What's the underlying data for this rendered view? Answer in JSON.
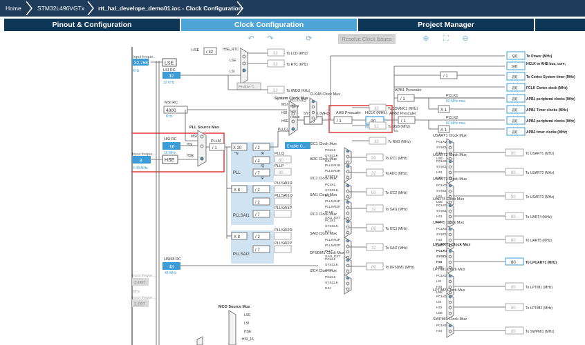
{
  "breadcrumb": {
    "home": "Home",
    "device": "STM32L496VGTx",
    "file": "rtt_hal_develope_demo01.ioc - Clock Configuration"
  },
  "tabs": {
    "pinout": "Pinout & Configuration",
    "clock": "Clock Configuration",
    "project": "Project Manager"
  },
  "toolbar": {
    "undo_icon": "undo-icon",
    "redo_icon": "redo-icon",
    "refresh_icon": "refresh-icon",
    "resolve": "Resolve Clock Issues",
    "zoom_in_icon": "zoom-in-icon",
    "fit_icon": "fit-screen-icon",
    "zoom_out_icon": "zoom-out-icon"
  },
  "sources": {
    "input_freq_lse_label": "Input freque...",
    "lse_value": "32.768",
    "lse_unit": "KHz",
    "lse": "LSE",
    "lsi_rc": "LSI RC",
    "lsi_value": "32",
    "lsi_unit": "32 KHz",
    "msi_rc": "MSI RC",
    "msi_value": "4000",
    "msi_unit": "KHz",
    "hsi_rc": "HSI RC",
    "hsi_value": "16",
    "hsi_unit": "16 MHz",
    "input_freq_hse_label": "Input freque...",
    "hse_value": "8",
    "hse_range": "4-48 MHz",
    "hse": "HSE",
    "hsi48_rc": "HSI48 RC",
    "hsi48_value": "48",
    "hsi48_unit": "48 MHz",
    "input_freq_3": "Input freque...",
    "input_3_value": "2.097",
    "input_3_unit": "MHz",
    "input_freq_4": "Input freque...",
    "input_4_value": "2.097"
  },
  "rtc": {
    "hse_label": "HSE",
    "hse_div": "/ 32",
    "hse_rtc": "HSE_RTC",
    "lse": "LSE",
    "lsi": "LSI",
    "enable_css": "Enable C...",
    "to_lcd": "To LCD (KHz)",
    "lcd_value": "32",
    "to_rtc": "To RTC (KHz)",
    "rtc_value": "32",
    "to_iwdg": "To IWDG (KHz)",
    "iwdg_value": "32"
  },
  "system_mux": {
    "title": "System Clock Mux",
    "msi": "MSI",
    "hsi": "HSI",
    "hse": "HSE",
    "pllclk": "PLLCLK",
    "enable_css": "Enable C..."
  },
  "sysclk": {
    "label": "SYSCLK (MHz)",
    "value": "80",
    "ahb_label": "AHB Prescaler",
    "ahb_value": "/ 1",
    "hclk_label": "HCLK (MHz)",
    "hclk_value": "80",
    "hclk_max": "80 MHz max"
  },
  "apb": {
    "apb1_label": "APB1 Prescaler",
    "apb1_value": "/ 1",
    "pclk1": "PCLK1",
    "pclk1_max": "80 MHz max",
    "x1_a": "X 1",
    "apb2_label": "APB2 Prescaler",
    "apb2_value": "/ 1",
    "pclk2": "PCLK2",
    "pclk2_max": "80 MHz max",
    "x1_b": "X 1",
    "cortex_div": "/ 1"
  },
  "outputs": [
    {
      "value": "80",
      "label": "To Power (MHz)"
    },
    {
      "value": "80",
      "label": "HCLK to AHB bus, core,"
    },
    {
      "value": "80",
      "label": "To Cortex System timer (MHz)"
    },
    {
      "value": "80",
      "label": "FCLK Cortex clock (MHz)"
    },
    {
      "value": "80",
      "label": "APB1 peripheral clocks (MHz)"
    },
    {
      "value": "80",
      "label": "APB1 Timer clocks (MHz)"
    },
    {
      "value": "80",
      "label": "APB2 peripheral clocks (MHz)"
    },
    {
      "value": "80",
      "label": "APB2 timer clocks (MHz)"
    }
  ],
  "pll": {
    "src_title": "PLL Source Mux",
    "msi": "MSI",
    "hsi": "HSI",
    "hse": "HSE",
    "pllm_label": "PLLM",
    "pllm_value": "/ 1",
    "pll_label": "PLL",
    "n_value": "X 20",
    "n_sub": "*N",
    "r_value": "/ 2",
    "r_sub": "/R",
    "q_value": "/ 2",
    "q_sub": "/Q",
    "p_value": "/ 7",
    "p_sub": "/P",
    "pllq": "PLLQ",
    "pllp": "PLLP",
    "pllq_value": "80",
    "pllp_value": "80",
    "sai1_label": "PLLSAI1",
    "sai1_n": "X 8",
    "sai1_r": "/ 2",
    "sai1_q": "/ 2",
    "sai1_p": "/ 7",
    "pllsai1r": "PLLSAI1R",
    "pllsai1q": "PLLSAI1Q",
    "pllsai1p": "PLLSAI1P",
    "sai2_label": "PLLSAI2",
    "sai2_n": "X 8",
    "sai2_r": "/ 2",
    "sai2_p": "/ 7",
    "pllsai2r": "PLLSAI2R",
    "pllsai2p": "PLLSAI2P"
  },
  "peripherals_left": [
    {
      "title": "CLK48 Clock Mux",
      "value": "32",
      "label": "To SDMMC1 (MHz)"
    },
    {
      "title": "",
      "value": "32",
      "label": "To USB (MHz)"
    },
    {
      "title": "",
      "value": "32",
      "label": "To RNG (MHz)"
    },
    {
      "title": "I2C1 Clock Mux",
      "value": "80",
      "label": "To I2C1 (MHz)"
    },
    {
      "title": "ADC Clock Mux",
      "value": "32",
      "label": "To ADC (MHz)"
    },
    {
      "title": "I2C2 Clock Mux",
      "value": "80",
      "label": "To I2C2 (MHz)"
    },
    {
      "title": "SAI1 Clock Mux",
      "value": "32",
      "label": "To SAI1 (MHz)"
    },
    {
      "title": "I2C3 Clock Mux",
      "value": "80",
      "label": "To I2C3 (MHz)"
    },
    {
      "title": "SAI2 Clock Mux",
      "value": "32",
      "label": "To SAI2 (MHz)"
    },
    {
      "title": "DFSDM1 Clock Mux",
      "value": "80",
      "label": "To DFSDM1 (MHz)"
    },
    {
      "title": "I2C4 Clock Mux",
      "value": "",
      "label": ""
    }
  ],
  "peripherals_right": [
    {
      "title": "USART1 Clock Mux",
      "value": "80",
      "label": "To USART1 (MHz)"
    },
    {
      "title": "USART2 Clock Mux",
      "value": "80",
      "label": "To USART2 (MHz)"
    },
    {
      "title": "USART3 Clock Mux",
      "value": "80",
      "label": "To USART3 (MHz)"
    },
    {
      "title": "UART4 Clock Mux",
      "value": "80",
      "label": "To UART4 (MHz)"
    },
    {
      "title": "UART5 Clock Mux",
      "value": "80",
      "label": "To UART5 (MHz)"
    },
    {
      "title": "LPUART1 Clock Mux",
      "value": "80",
      "label": "To LPUART1 (MHz)"
    },
    {
      "title": "LPTIM1 Clock Mux",
      "value": "80",
      "label": "To LPTIM1 (MHz)"
    },
    {
      "title": "LPTIM2 Clock Mux",
      "value": "80",
      "label": "To LPTIM2 (MHz)"
    },
    {
      "title": "SWPMI1 Clock Mux",
      "value": "80",
      "label": "To SWPMI1 (MHz)"
    }
  ],
  "mux_inputs": {
    "clk48": [
      "PLLSAI1Q",
      "PLLQ",
      "MSI",
      "HSI48"
    ],
    "i2c": [
      "PCLK1",
      "SYSCLK",
      "HSI"
    ],
    "adc": [
      "PLLSAI1R",
      "PLLSAI2R",
      "SYSCLK"
    ],
    "sai": [
      "PLLSAI1P",
      "PLLSAI2P",
      "PLLP",
      "SAI1_EXT"
    ],
    "sai2": [
      "PLLSAI1P",
      "PLLSAI2P",
      "PLLP",
      "SAI2_EXT"
    ],
    "usart1": [
      "PCLK2",
      "SYSCLK",
      "HSI",
      "LSE"
    ],
    "usart": [
      "PCLK1",
      "SYSCLK",
      "HSI",
      "LSE"
    ],
    "lptim": [
      "PCLK1",
      "LSI",
      "HSI",
      "LSE"
    ],
    "swpmi": [
      "PCLK1",
      "HSI"
    ]
  },
  "mco": {
    "title": "MCO Source Mux",
    "lse": "LSE",
    "lsi": "LSI",
    "hse": "HSE",
    "hsi16": "HSI_16"
  },
  "colors": {
    "header": "#1f3d5b",
    "tab": "#0e3657",
    "tab_active": "#4fa4d6",
    "accent": "#3d9bd8",
    "highlight": "#e03a3a"
  }
}
